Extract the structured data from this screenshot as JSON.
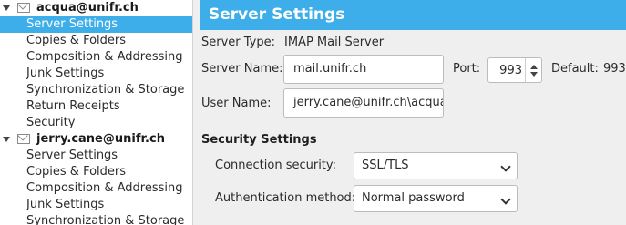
{
  "sidebar": {
    "accounts": [
      {
        "name": "acqua@unifr.ch",
        "items": [
          "Server Settings",
          "Copies & Folders",
          "Composition & Addressing",
          "Junk Settings",
          "Synchronization & Storage",
          "Return Receipts",
          "Security"
        ],
        "selected_index": 0
      },
      {
        "name": "jerry.cane@unifr.ch",
        "items": [
          "Server Settings",
          "Copies & Folders",
          "Composition & Addressing",
          "Junk Settings",
          "Synchronization & Storage"
        ]
      }
    ]
  },
  "page": {
    "title": "Server Settings",
    "server_type_label": "Server Type:",
    "server_type_value": "IMAP Mail Server",
    "server_name_label": "Server Name:",
    "server_name_value": "mail.unifr.ch",
    "port_label": "Port:",
    "port_value": "993",
    "default_label": "Default:",
    "default_value": "993",
    "user_name_label": "User Name:",
    "user_name_value": "jerry.cane@unifr.ch\\acqua",
    "security_heading": "Security Settings",
    "connection_security_label": "Connection security:",
    "connection_security_value": "SSL/TLS",
    "auth_method_label": "Authentication method:",
    "auth_method_value": "Normal password"
  },
  "colors": {
    "accent": "#3daee9",
    "background": "#efefef"
  }
}
